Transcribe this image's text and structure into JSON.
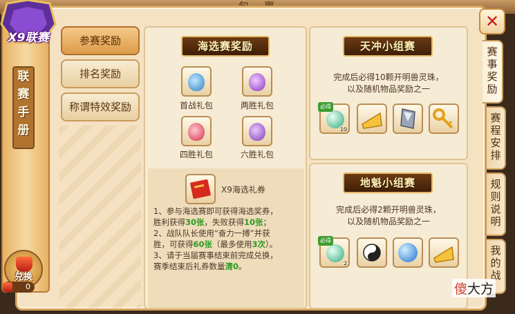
{
  "window_title": "包 裹",
  "logo_text": "X9联赛",
  "banner_title": [
    "联",
    "赛",
    "手",
    "册"
  ],
  "exchange": {
    "label": "兑换",
    "count": "0"
  },
  "menu": [
    {
      "label": "参赛奖励",
      "active": true
    },
    {
      "label": "排名奖励",
      "active": false
    },
    {
      "label": "称谓特效奖励",
      "active": false
    }
  ],
  "haixuan": {
    "title": "海选赛奖励",
    "items": [
      {
        "label": "首战礼包",
        "icon": "blue-gift-bag-icon",
        "color": "#4aa3d8"
      },
      {
        "label": "两胜礼包",
        "icon": "purple-gift-bag-icon",
        "color": "#b05ad6"
      },
      {
        "label": "四胜礼包",
        "icon": "red-gift-bag-icon",
        "color": "#e0455a"
      },
      {
        "label": "六胜礼包",
        "icon": "violet-gift-bag-icon",
        "color": "#9d5ac9"
      }
    ],
    "ticket": {
      "label": "X9海选礼券",
      "icon": "red-ticket-icon"
    },
    "notes": [
      [
        "1、参与海选赛即可获得海选奖券，",
        "胜利获得",
        "30张",
        "，失败获得",
        "10张",
        "；"
      ],
      [
        "2、战队队长使用“奋力一搏”并获",
        "胜，可获得",
        "60张",
        "（最多使用",
        "3次",
        "）。"
      ],
      [
        "3、请于当届赛事结束前完成兑换，",
        "赛季结束后礼券数量",
        "清0",
        "。",
        "",
        ""
      ]
    ]
  },
  "tianchong": {
    "title": "天冲小组赛",
    "desc": [
      "完成后必得10颗开明兽灵珠，",
      "以及随机物品奖励之一"
    ],
    "must_label": "必得",
    "main_count": "10",
    "items": [
      "cheese-icon",
      "crystal-icon",
      "key-icon"
    ]
  },
  "dikui": {
    "title": "地魁小组赛",
    "desc": [
      "完成后必得2颗开明兽灵珠，",
      "以及随机物品奖励之一"
    ],
    "must_label": "必得",
    "main_count": "2",
    "items": [
      "yinyang-icon",
      "blue-orb-icon",
      "cheese-icon"
    ]
  },
  "side_tabs": [
    {
      "label": "赛事奖励",
      "active": true
    },
    {
      "label": "赛程安排",
      "active": false
    },
    {
      "label": "规则说明",
      "active": false
    },
    {
      "label": "我的战",
      "active": false
    }
  ],
  "watermark": {
    "red": "傻",
    "rest": "大方"
  }
}
